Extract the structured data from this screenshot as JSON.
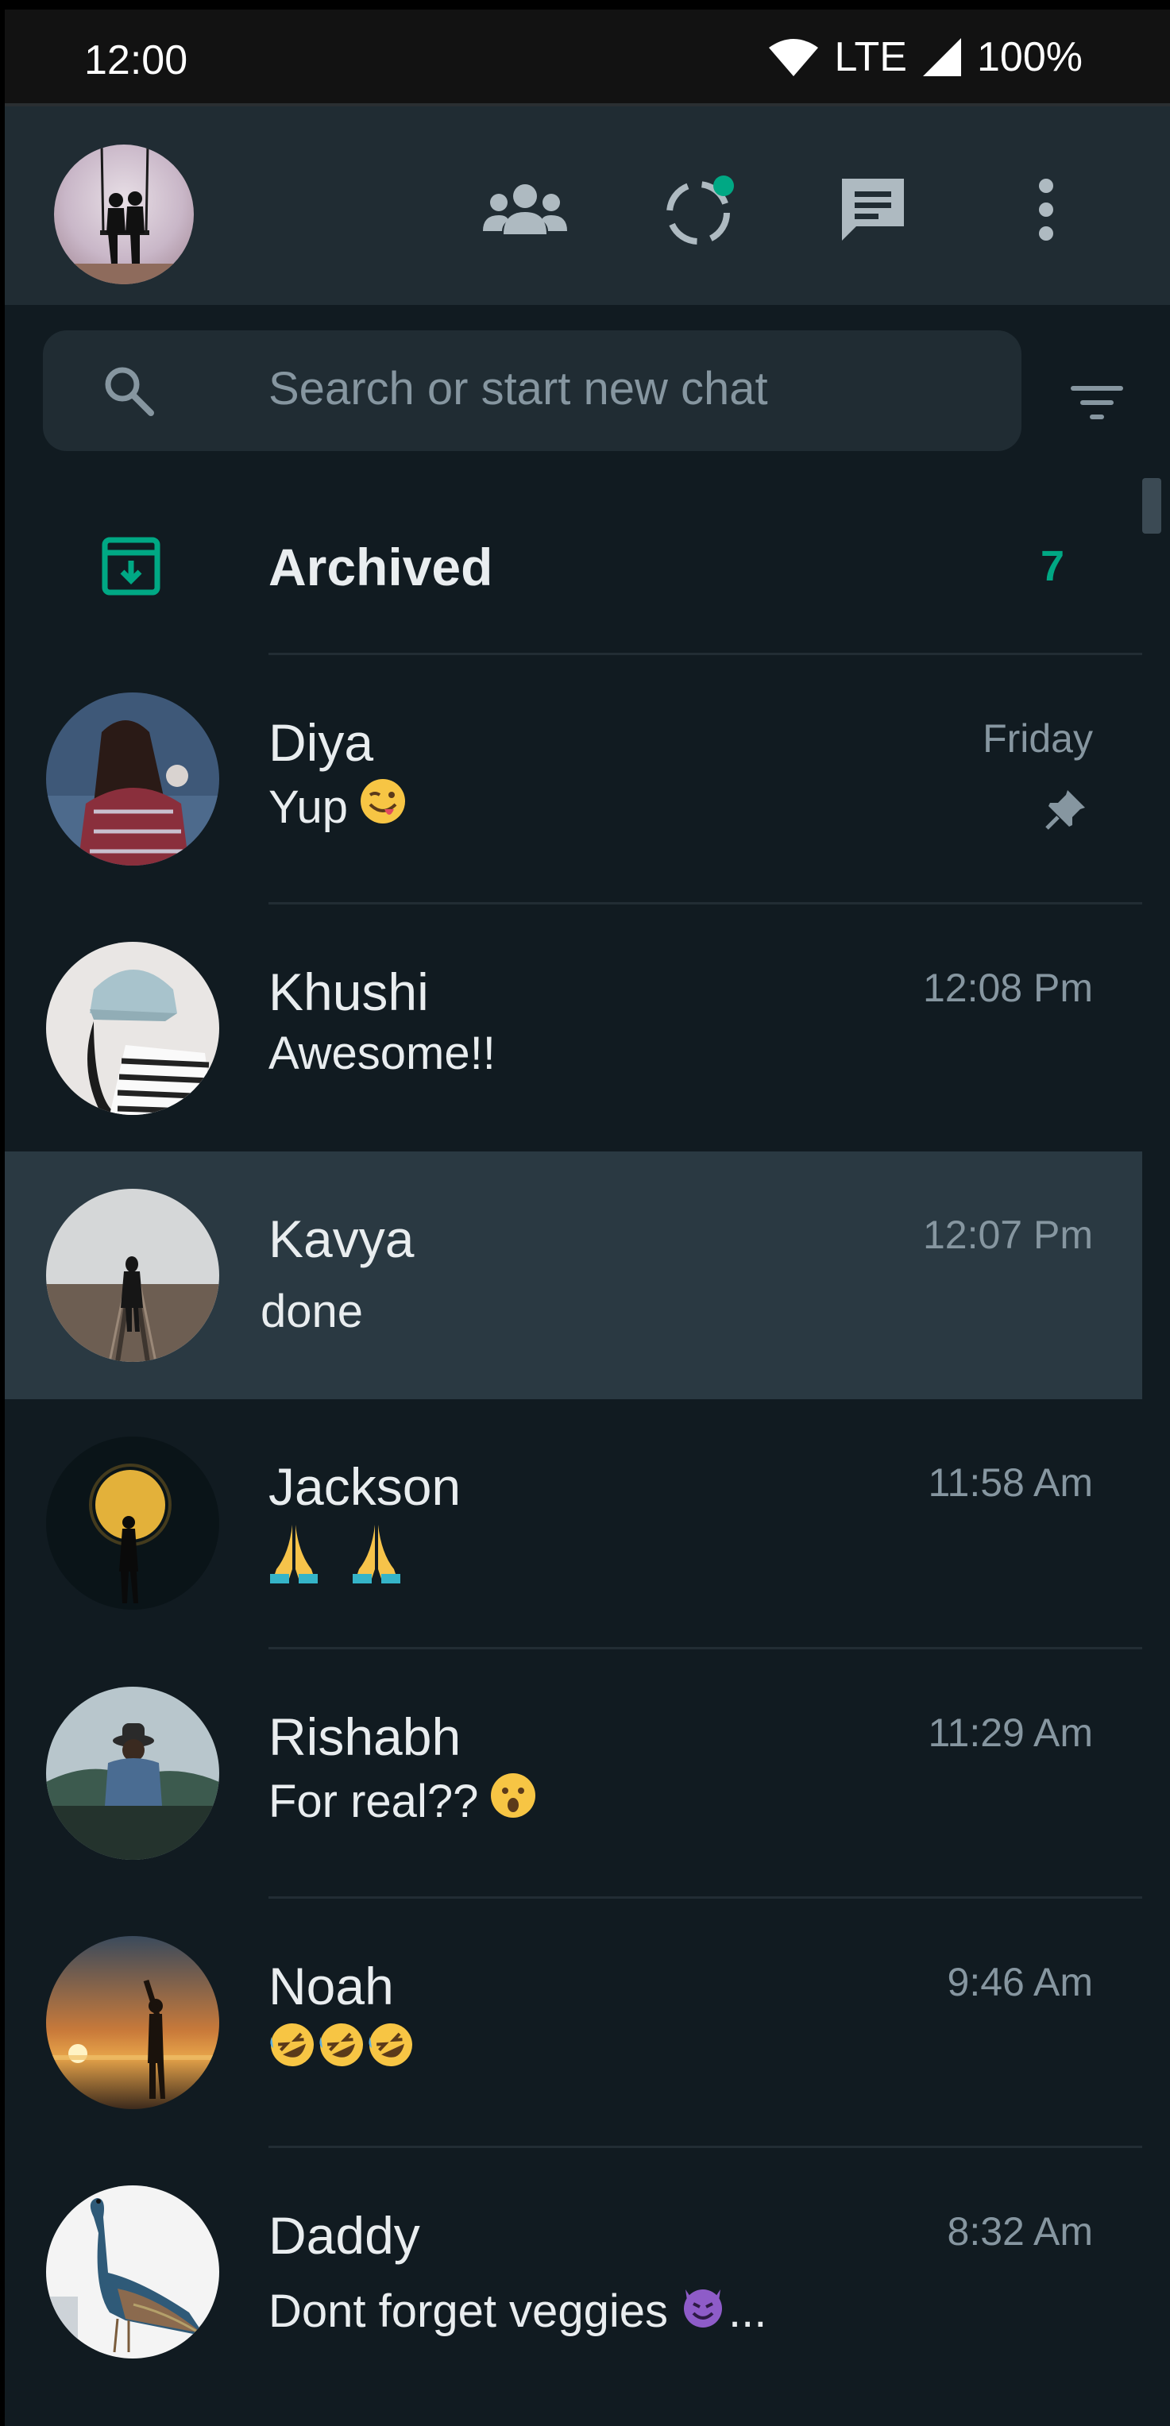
{
  "status_bar": {
    "time": "12:00",
    "network": "LTE",
    "battery": "100%"
  },
  "header": {
    "icons": [
      "communities-icon",
      "status-icon",
      "new-chat-icon",
      "more-options-icon"
    ],
    "accent": "#00a884"
  },
  "search": {
    "placeholder": "Search or start new chat"
  },
  "archived": {
    "label": "Archived",
    "count": "7"
  },
  "chats": [
    {
      "name": "Diya",
      "time": "Friday",
      "message": "Yup",
      "emoji": "winking-tongue-emoji",
      "pinned": true
    },
    {
      "name": "Khushi",
      "time": "12:08 Pm",
      "message": "Awesome!!"
    },
    {
      "name": "Kavya",
      "time": "12:07 Pm",
      "message": "done",
      "selected": true
    },
    {
      "name": "Jackson",
      "time": "11:58 Am",
      "message": "",
      "emoji": "folded-hands-emoji x2"
    },
    {
      "name": "Rishabh",
      "time": "11:29 Am",
      "message": "For real??",
      "emoji": "surprised-face-emoji"
    },
    {
      "name": "Noah",
      "time": "9:46 Am",
      "message": "",
      "emoji": "rofl-emoji x3"
    },
    {
      "name": "Daddy",
      "time": "8:32 Am",
      "message": "Dont forget veggies",
      "emoji": "smiling-imp-emoji",
      "suffix": "..."
    }
  ],
  "colors": {
    "background": "#111b21",
    "panel": "#202c33",
    "selected_row": "#2a3942",
    "primary_text": "#e9edef",
    "secondary_text": "#8696a0",
    "accent": "#00a884"
  }
}
